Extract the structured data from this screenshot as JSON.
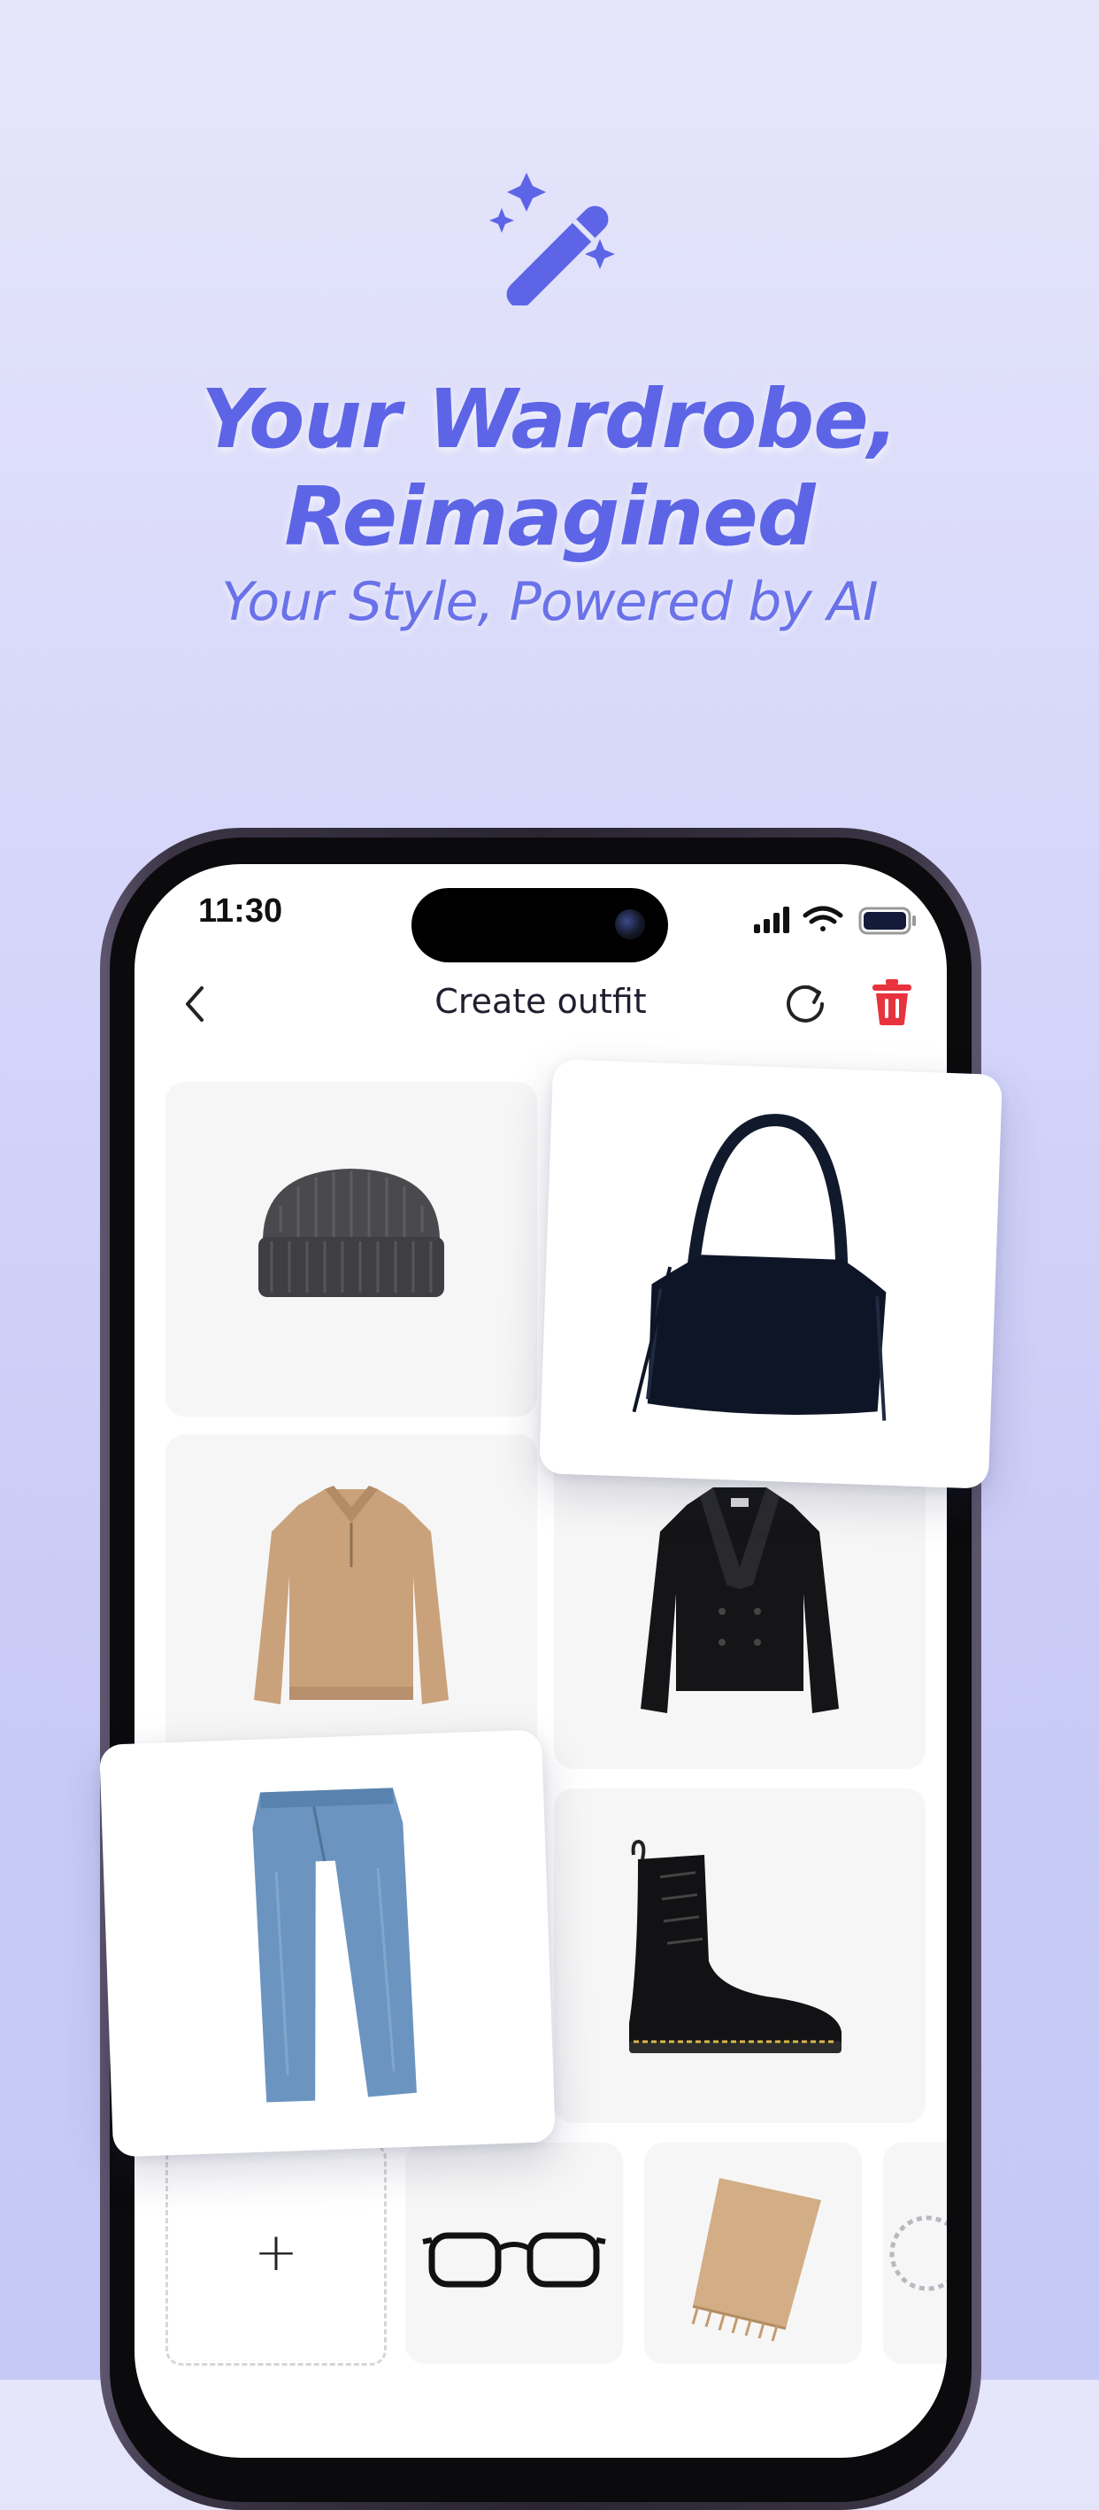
{
  "hero": {
    "icon": "magic-wand-icon",
    "title_line1": "Your Wardrobe,",
    "title_line2": "Reimagined",
    "tagline": "Your Style, Powered by AI"
  },
  "status_bar": {
    "time": "11:30",
    "icons": [
      "cellular-signal-icon",
      "wifi-icon",
      "battery-icon"
    ]
  },
  "nav": {
    "back_icon": "chevron-left-icon",
    "title": "Create outfit",
    "refresh_icon": "refresh-icon",
    "delete_icon": "trash-icon"
  },
  "outfit_items": [
    {
      "name": "beanie",
      "icon": "beanie-image"
    },
    {
      "name": "shoulder-bag",
      "icon": "bag-image"
    },
    {
      "name": "sweater",
      "icon": "sweater-image"
    },
    {
      "name": "jacket",
      "icon": "jacket-image"
    },
    {
      "name": "jeans",
      "icon": "jeans-image"
    },
    {
      "name": "boots",
      "icon": "boots-image"
    }
  ],
  "accessories": {
    "add_label": "+",
    "items": [
      "glasses-image",
      "scarf-image",
      "bracelet-image"
    ]
  },
  "colors": {
    "accent": "#5d65e6",
    "delete": "#e8333f",
    "background_top": "#e6e6fb",
    "background_bottom": "#c6c8f5"
  }
}
